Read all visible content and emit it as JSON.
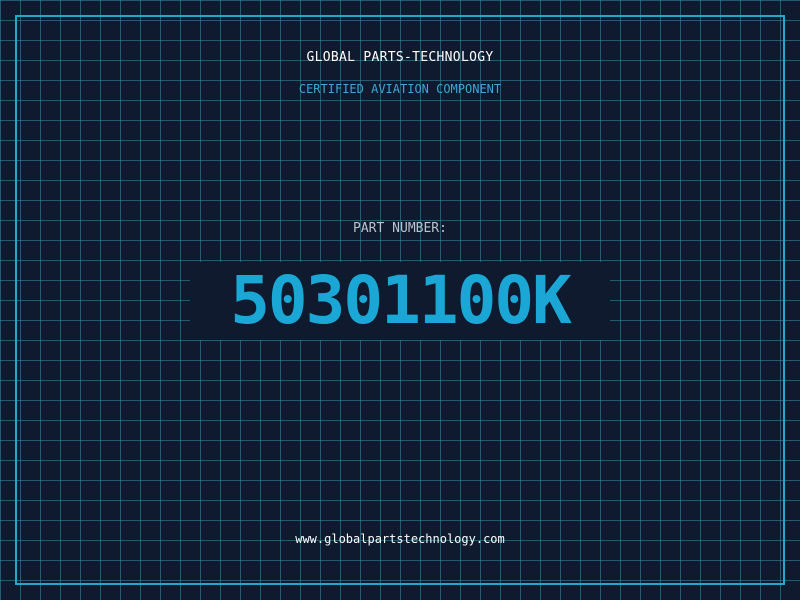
{
  "header": {
    "company": "GLOBAL PARTS-TECHNOLOGY",
    "subtitle": "CERTIFIED AVIATION COMPONENT"
  },
  "part": {
    "label": "PART NUMBER:",
    "number": "50301100K"
  },
  "footer": {
    "website": "www.globalpartstechnology.com"
  },
  "colors": {
    "background": "#0f1a2e",
    "grid": "#388caa",
    "accent": "#1aa7d6",
    "frame": "#22a8cc"
  }
}
